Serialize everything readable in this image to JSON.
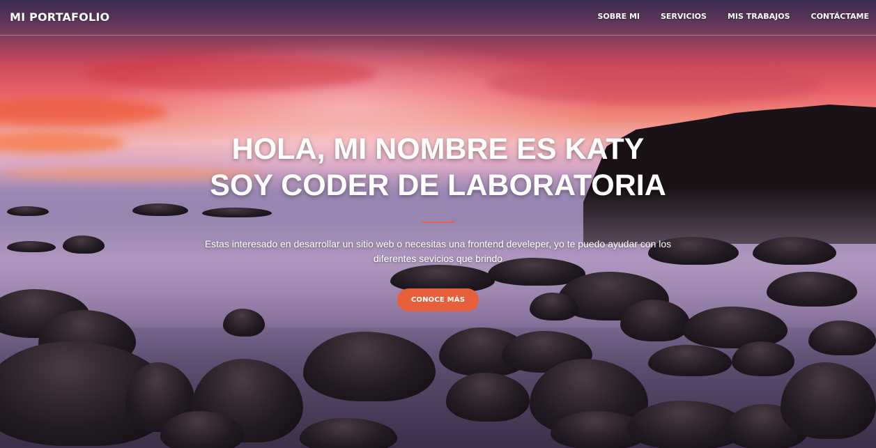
{
  "navbar": {
    "brand": "MI PORTAFOLIO",
    "links": [
      {
        "label": "SOBRE MI"
      },
      {
        "label": "SERVICIOS"
      },
      {
        "label": "MIS TRABAJOS"
      },
      {
        "label": "CONTÁCTAME"
      }
    ]
  },
  "hero": {
    "headline_line1": "HOLA, MI NOMBRE ES KATY",
    "headline_line2": "SOY CODER DE LABORATORIA",
    "subtext": "Estas interesado en desarrollar un sitio web o necesitas una frontend develeper, yo te puedo ayudar con los diferentes sevicios que brindo",
    "cta_label": "CONOCE MÁS"
  },
  "colors": {
    "accent": "#f05f40",
    "button": "#e85f3c",
    "text": "#ffffff"
  }
}
